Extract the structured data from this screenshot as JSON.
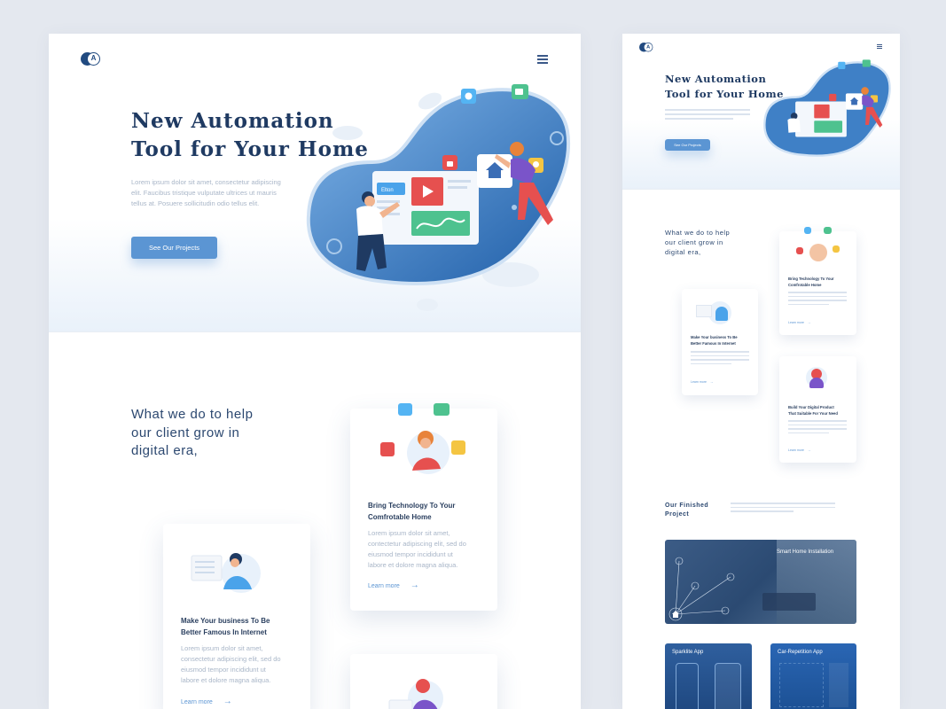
{
  "colors": {
    "background": "#e4e8ef",
    "navy": "#1f3a62",
    "accent_blue": "#5b95d3",
    "muted_text": "#a9b6c8"
  },
  "icons": [
    "logo-icon",
    "menu-icon",
    "arrow-right-icon",
    "home-icon",
    "wifi-icon",
    "camera-icon",
    "lock-icon",
    "bulb-icon",
    "play-icon"
  ],
  "left": {
    "hero": {
      "title_line1": "New Automation",
      "title_line2": "Tool for Your Home",
      "desc_line1": "Lorem ipsum dolor sit amet, consectetur adipiscing",
      "desc_line2": "elit. Faucibus tristique vulputate ultrices ut mauris",
      "desc_line3": "tellus at. Posuere sollicitudin odio tellus elit.",
      "cta": "See Our Projects",
      "screen_tag": "Elton"
    },
    "services": {
      "title_line1": "What we do to help",
      "title_line2": "our client grow in",
      "title_line3": "digital era,",
      "cards": [
        {
          "title_line1": "Bring Technology To Your",
          "title_line2": "Comfrotable Home",
          "text_line1": "Lorem ipsum dolor sit amet,",
          "text_line2": "contectetur adipiscing elit, sed do",
          "text_line3": "eiusmod tempor incididunt ut",
          "text_line4": "labore et dolore magna aliqua.",
          "link": "Learn more"
        },
        {
          "title_line1": "Make Your business To Be",
          "title_line2": "Better Famous In Internet",
          "text_line1": "Lorem ipsum dolor sit amet,",
          "text_line2": "consectetur adipiscing elit, sed do",
          "text_line3": "eiusmod tempor incididunt ut",
          "text_line4": "labore et dolore magna aliqua.",
          "link": "Learn more"
        }
      ]
    }
  },
  "right": {
    "hero": {
      "title_line1": "New Automation",
      "title_line2": "Tool for Your Home",
      "cta": "See Our Projects"
    },
    "services": {
      "title_line1": "What we do to help",
      "title_line2": "our client grow in",
      "title_line3": "digital era,",
      "cards": [
        {
          "title_line1": "Bring Technology To Your",
          "title_line2": "Comfrotable Home",
          "link": "Learn more"
        },
        {
          "title_line1": "Make Your business To Be",
          "title_line2": "Better Famous In Internet",
          "link": "Learn more"
        },
        {
          "title_line1": "Build Your Digital Product",
          "title_line2": "That Suitable For Your Need",
          "link": "Learn more"
        }
      ]
    },
    "projects": {
      "title_line1": "Our Finished",
      "title_line2": "Project",
      "items": [
        "Smart Home Installation",
        "Sparklite App",
        "Car-Repetition App"
      ]
    }
  }
}
